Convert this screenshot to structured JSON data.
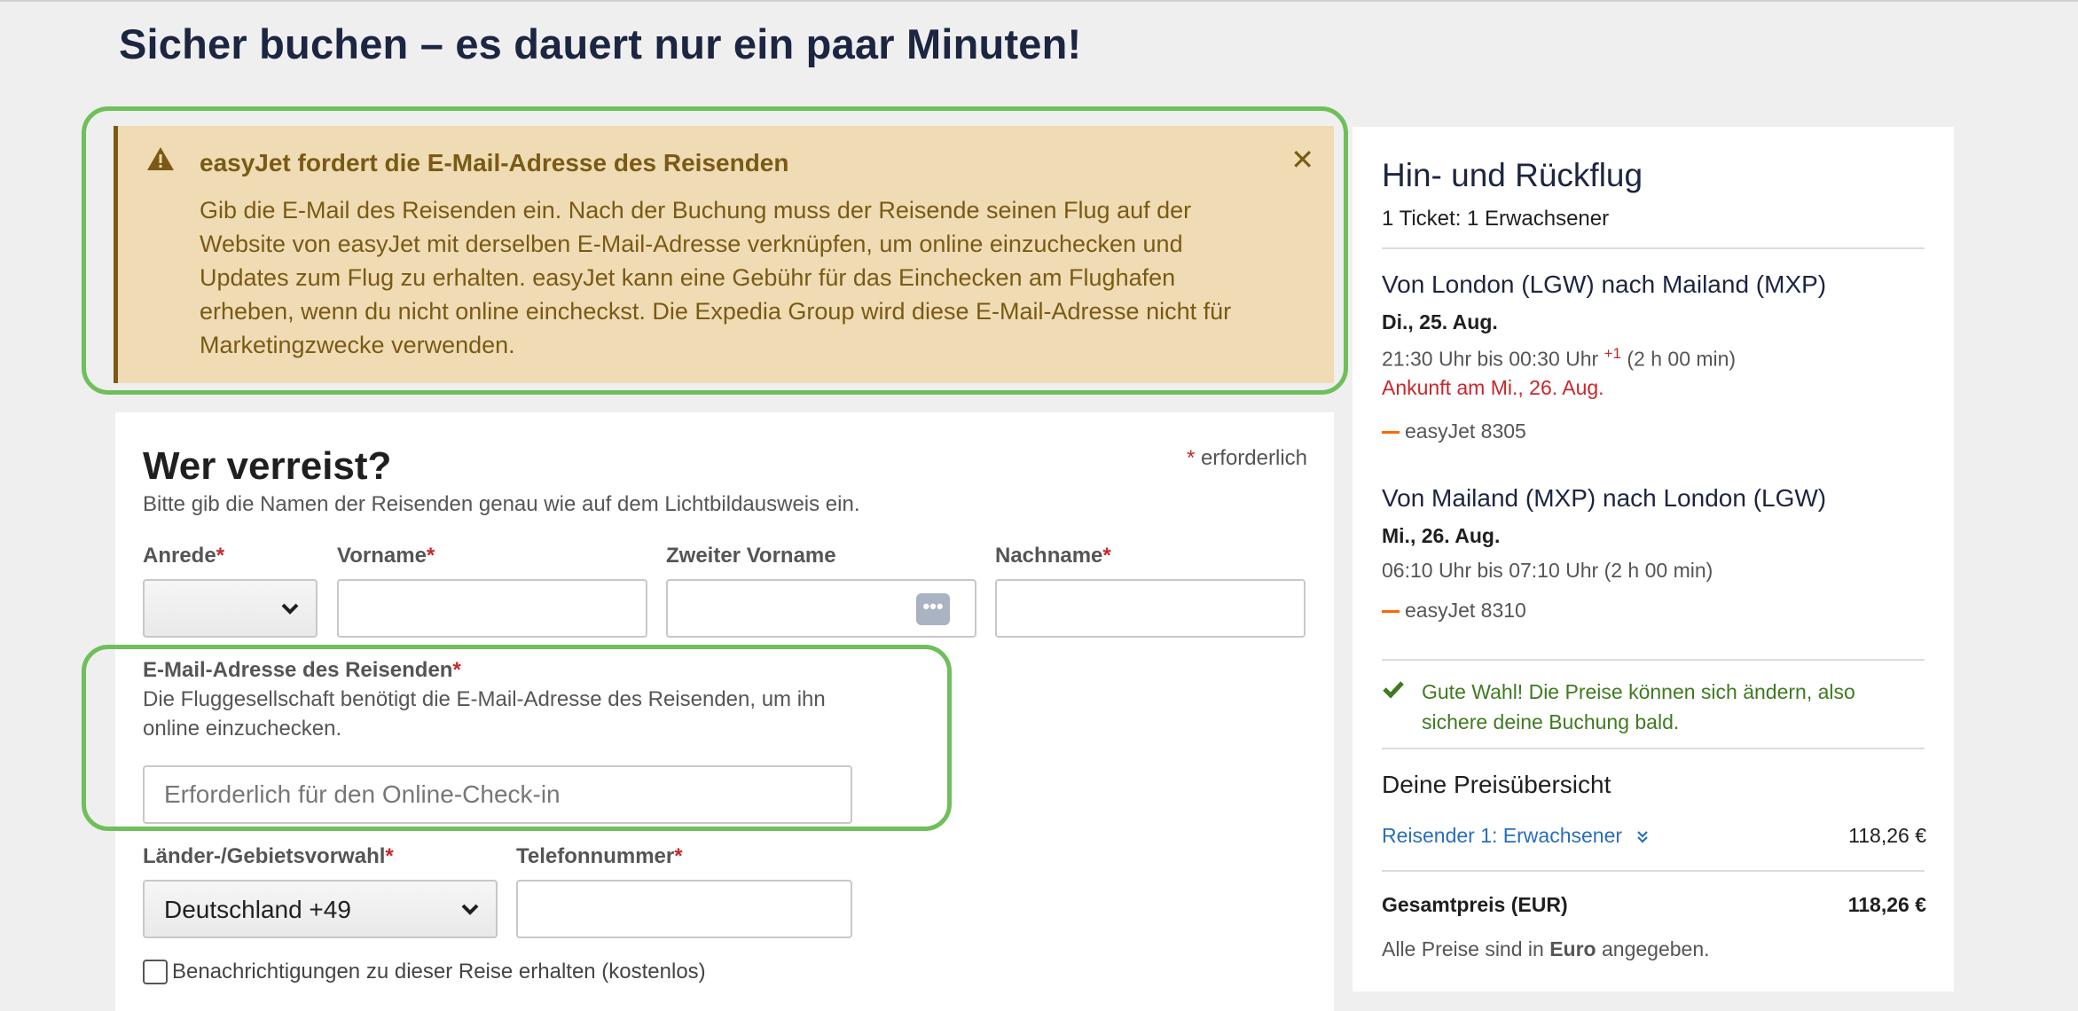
{
  "page": {
    "title": "Sicher buchen – es dauert nur ein paar Minuten!"
  },
  "alert": {
    "title": "easyJet fordert die E-Mail-Adresse des Reisenden",
    "close_icon": "close-icon",
    "body": "Gib die E-Mail des Reisenden ein. Nach der Buchung muss der Reisende seinen Flug auf der Website von easyJet mit derselben E-Mail-Adresse verknüpfen, um online einzuchecken und Updates zum Flug zu erhalten. easyJet kann eine Gebühr für das Einchecken am Flughafen erheben, wenn du nicht online eincheckst. Die Expedia Group wird diese E-Mail-Adresse nicht für Marketingzwecke verwenden."
  },
  "form": {
    "heading": "Wer verreist?",
    "required_star": "*",
    "required_note": "erforderlich",
    "subtitle": "Bitte gib die Namen der Reisenden genau wie auf dem Lichtbildausweis ein.",
    "salutation_label": "Anrede",
    "firstname_label": "Vorname",
    "middlename_label": "Zweiter Vorname",
    "lastname_label": "Nachname",
    "email_label": "E-Mail-Adresse des Reisenden",
    "email_help": "Die Fluggesellschaft benötigt die E-Mail-Adresse des Reisenden, um ihn online einzuchecken.",
    "email_placeholder": "Erforderlich für den Online-Check-in",
    "country_label": "Länder-/Gebietsvorwahl",
    "country_value": "Deutschland +49",
    "phone_label": "Telefonnummer",
    "notifications_label": "Benachrichtigungen zu dieser Reise erhalten (kostenlos)"
  },
  "summary": {
    "title": "Hin- und Rückflug",
    "ticket": "1 Ticket: 1 Erwachsener",
    "outbound": {
      "route": "Von London (LGW) nach Mailand (MXP)",
      "date": "Di., 25. Aug.",
      "time": "21:30 Uhr bis 00:30 Uhr",
      "day_offset": "+1",
      "duration": "(2 h 00 min)",
      "arrival": "Ankunft am Mi., 26. Aug.",
      "airline": "easyJet 8305"
    },
    "return": {
      "route": "Von Mailand (MXP) nach London (LGW)",
      "date": "Mi., 26. Aug.",
      "time": "06:10 Uhr bis 07:10 Uhr (2 h 00 min)",
      "airline": "easyJet 8310"
    },
    "good_choice": "Gute Wahl! Die Preise können sich ändern, also sichere deine Buchung bald.",
    "price_heading": "Deine Preisübersicht",
    "traveler_label": "Reisender 1: Erwachsener",
    "traveler_price": "118,26 €",
    "total_label": "Gesamtpreis (EUR)",
    "total_price": "118,26 €",
    "currency_prefix": "Alle Preise sind in",
    "currency_name": "Euro",
    "currency_suffix": "angegeben."
  },
  "colors": {
    "alert_bg": "#efdcb5",
    "alert_text": "#7a5a14",
    "highlight": "#6fbf5a",
    "required": "#c8262a",
    "link": "#2a6ebb",
    "success": "#3f7a20"
  }
}
